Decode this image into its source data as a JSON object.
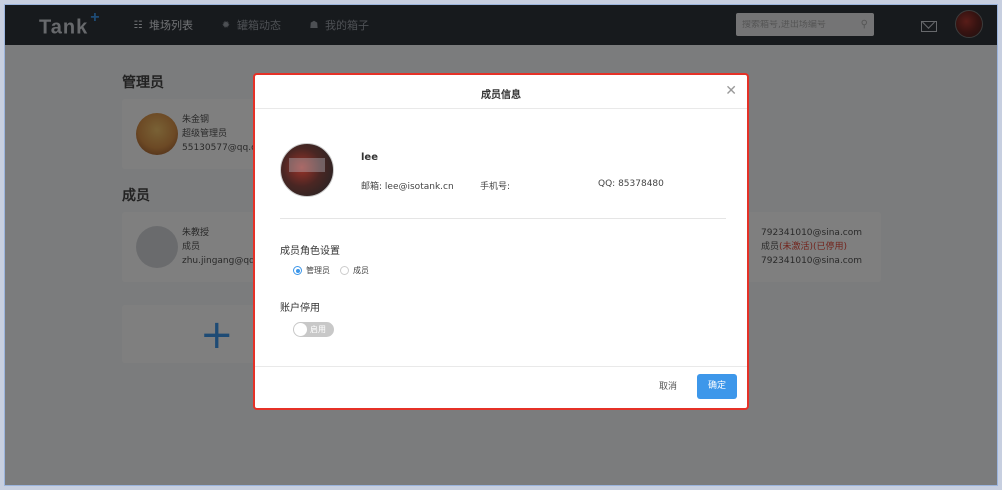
{
  "app": {
    "logo": "Tank",
    "logo_plus": "+"
  },
  "nav": {
    "items": [
      {
        "icon": "grid-icon",
        "label": "堆场列表"
      },
      {
        "icon": "gear-icon",
        "label": "罐箱动态"
      },
      {
        "icon": "user-icon",
        "label": "我的箱子"
      }
    ]
  },
  "search": {
    "placeholder": "搜索箱号,进出场编号"
  },
  "page": {
    "admins_title": "管理员",
    "members_title": "成员",
    "admin_card": {
      "name": "朱金钢",
      "role": "超级管理员",
      "email": "55130577@qq.com"
    },
    "member_card": {
      "name": "朱教授",
      "role": "成员",
      "email": "zhu.jingang@qq.com"
    },
    "member_card_2": {
      "email_1": "792341010@sina.com",
      "role_prefix": "成员",
      "role_status": "(未激活)(已停用)",
      "email_2": "792341010@sina.com"
    }
  },
  "modal": {
    "title": "成员信息",
    "name": "lee",
    "email_label": "邮箱:",
    "email": "lee@isotank.cn",
    "phone_label": "手机号:",
    "phone": "",
    "qq_label": "QQ:",
    "qq": "85378480",
    "role_section": "成员角色设置",
    "role_options": [
      {
        "label": "管理员",
        "checked": true
      },
      {
        "label": "成员",
        "checked": false
      }
    ],
    "disable_section": "账户停用",
    "toggle_label": "启用",
    "cancel": "取消",
    "confirm": "确定"
  },
  "colors": {
    "accent": "#3d97ea",
    "danger": "#e53127"
  }
}
